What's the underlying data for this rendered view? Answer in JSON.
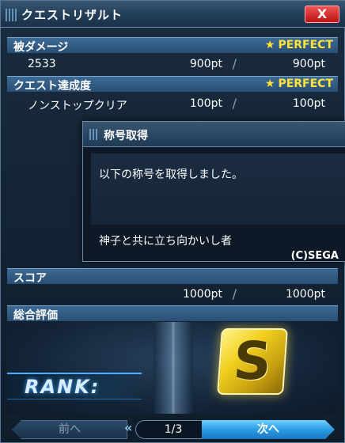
{
  "window": {
    "title": "クエストリザルト",
    "close_label": "X"
  },
  "sections": {
    "damage": {
      "label": "被ダメージ",
      "rating": "PERFECT",
      "name": "2533",
      "earned": "900pt",
      "max": "900pt"
    },
    "completion": {
      "label": "クエスト達成度",
      "rating": "PERFECT",
      "name": "ノンストップクリア",
      "earned": "100pt",
      "max": "100pt"
    },
    "score": {
      "label": "スコア",
      "earned": "1000pt",
      "max": "1000pt"
    },
    "overall": {
      "label": "総合評価"
    }
  },
  "popup": {
    "title": "称号取得",
    "message": "以下の称号を取得しました。",
    "title_name": "神子と共に立ち向かいし者",
    "copyright": "(C)SEGA"
  },
  "rank": {
    "label": "RANK:",
    "grade": "S"
  },
  "footer": {
    "prev_label": "前へ",
    "next_label": "次へ",
    "page": "1/3"
  },
  "icons": {
    "star": "star-icon",
    "close": "close-icon",
    "slash": "slash-separator"
  },
  "colors": {
    "perfect": "#ffe23a",
    "accent": "#2b9be6",
    "close": "#cc2222"
  }
}
